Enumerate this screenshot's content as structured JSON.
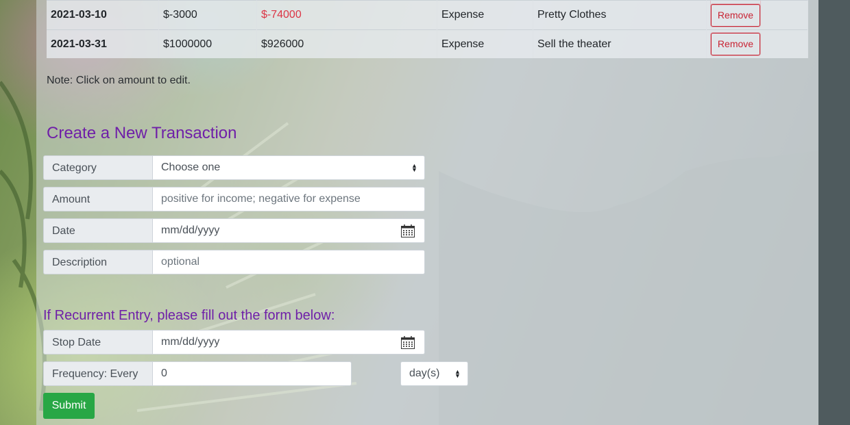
{
  "transactions": {
    "rows": [
      {
        "date": "2021-03-10",
        "amount": "$-3000",
        "balance": "$-74000",
        "balance_negative": true,
        "category": "Expense",
        "description": "Pretty Clothes",
        "action": "Remove"
      },
      {
        "date": "2021-03-31",
        "amount": "$1000000",
        "balance": "$926000",
        "balance_negative": false,
        "category": "Expense",
        "description": "Sell the theater",
        "action": "Remove"
      }
    ],
    "note": "Note: Click on amount to edit."
  },
  "create_form": {
    "heading": "Create a New Transaction",
    "category_label": "Category",
    "category_value": "Choose one",
    "amount_label": "Amount",
    "amount_placeholder": "positive for income; negative for expense",
    "date_label": "Date",
    "date_placeholder": "mm/dd/yyyy",
    "description_label": "Description",
    "description_placeholder": "optional"
  },
  "recurrent_form": {
    "heading": "If Recurrent Entry, please fill out the form below:",
    "stop_date_label": "Stop Date",
    "stop_date_placeholder": "mm/dd/yyyy",
    "frequency_label": "Frequency: Every",
    "frequency_value": "0",
    "frequency_unit": "day(s)",
    "submit_label": "Submit"
  },
  "colors": {
    "heading": "#6f1fa8",
    "negative": "#dc3545",
    "remove": "#c82333",
    "submit": "#28a745"
  }
}
